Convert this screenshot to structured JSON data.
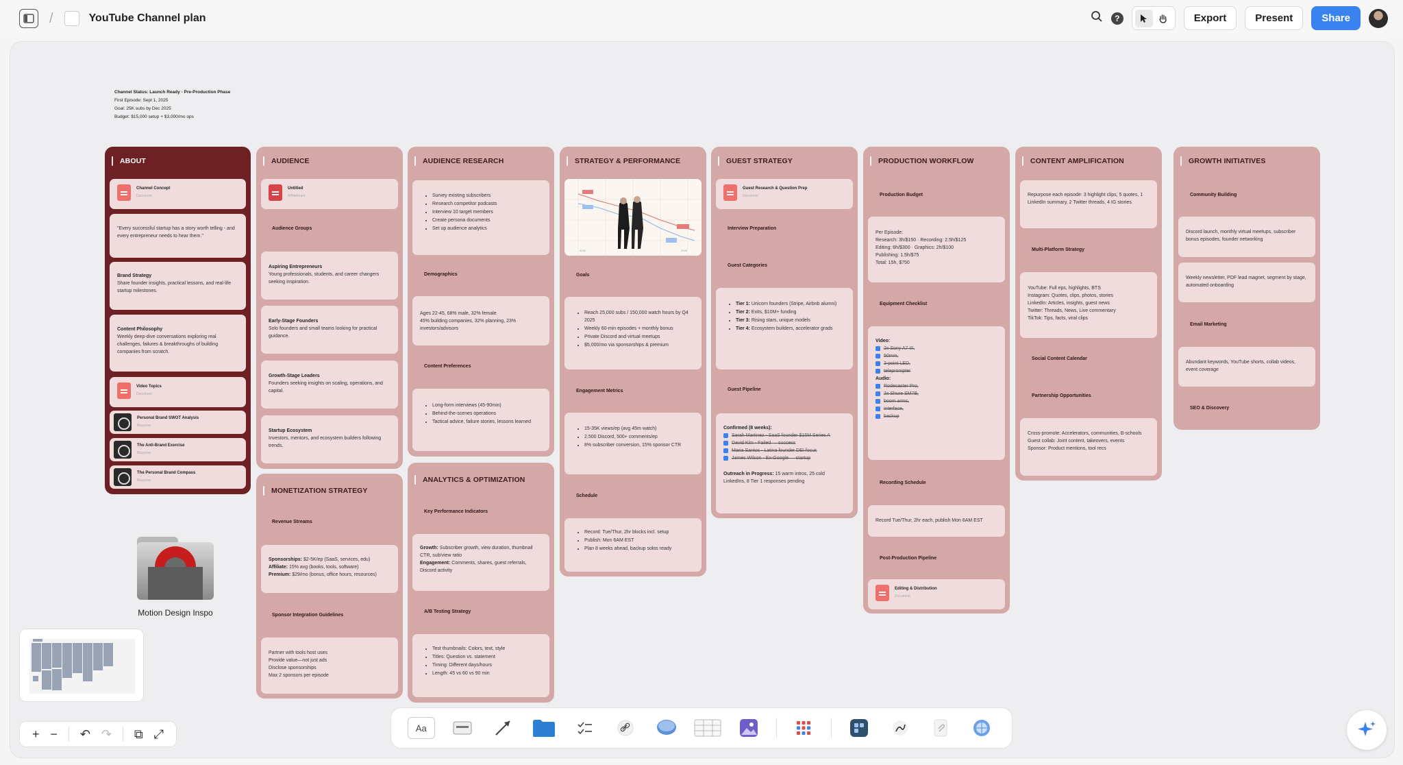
{
  "app": {
    "breadcrumb_sep": "/",
    "title": "YouTube Channel plan",
    "export_label": "Export",
    "present_label": "Present",
    "share_label": "Share",
    "help_glyph": "?"
  },
  "status": {
    "heading": "Channel Status: Launch Ready - Pre-Production Phase",
    "line1": "First Episode: Sept 1, 2025",
    "line2": "Goal: 25K subs by Dec 2025",
    "line3": "Budget: $15,000 setup + $3,000/mo ops"
  },
  "about": {
    "title": "ABOUT",
    "doc1": {
      "name": "Channel Concept",
      "sub": "Document"
    },
    "quote": "\"Every successful startup has a story worth telling - and every entrepreneur needs to hear them.\"",
    "brand_title": "Brand Strategy",
    "brand_body": "Share founder insights, practical lessons, and real-life startup milestones.",
    "philosophy_title": "Content Philosophy",
    "philosophy_body": "Weekly deep-dive conversations exploring real challenges, failures & breakthroughs of building companies from scratch.",
    "doc2": {
      "name": "Video Topics",
      "sub": "Document"
    },
    "bp1": {
      "name": "Personal Brand SWOT Analysis",
      "sub": "Blueprint"
    },
    "bp2": {
      "name": "The Anti-Brand Exercise",
      "sub": "Blueprint"
    },
    "bp3": {
      "name": "The Personal Brand Compass",
      "sub": "Blueprint"
    }
  },
  "audience": {
    "title": "AUDIENCE",
    "wb": {
      "name": "Untitled",
      "sub": "Whiteboard"
    },
    "groups_label": "Audience Groups",
    "g1_title": "Aspiring Entrepreneurs",
    "g1_body": "Young professionals, students, and career changers seeking inspiration.",
    "g2_title": "Early-Stage Founders",
    "g2_body": "Solo founders and small teams looking for practical guidance.",
    "g3_title": "Growth-Stage Leaders",
    "g3_body": "Founders seeking insights on scaling, operations, and capital.",
    "g4_title": "Startup Ecosystem",
    "g4_body": "Investors, mentors, and ecosystem builders following trends."
  },
  "monetization": {
    "title": "MONETIZATION STRATEGY",
    "revenue_label": "Revenue Streams",
    "r1_k": "Sponsorships:",
    "r1_v": " $2-5K/ep (SaaS, services, edu)",
    "r2_k": "Affiliate:",
    "r2_v": " 15% avg (books, tools, software)",
    "r3_k": "Premium:",
    "r3_v": " $29/mo (bonus, office hours, resources)",
    "sponsor_label": "Sponsor Integration Guidelines",
    "s1": "Partner with tools host uses",
    "s2": "Provide value—not just ads",
    "s3": "Disclose sponsorships",
    "s4": "Max 2 sponsors per episode"
  },
  "research": {
    "title": "AUDIENCE RESEARCH",
    "items": [
      "Survey existing subscribers",
      "Research competitor podcasts",
      "Interview 10 target members",
      "Create persona documents",
      "Set up audience analytics"
    ],
    "demo_label": "Demographics",
    "demo_l1": "Ages 22-45, 68% male, 32% female",
    "demo_l2": "45% building companies, 32% planning, 23% investors/advisors",
    "pref_label": "Content Preferences",
    "prefs": [
      "Long-form interviews (45-90min)",
      "Behind-the-scenes operations",
      "Tactical advice, failure stories, lessons learned"
    ]
  },
  "analytics": {
    "title": "ANALYTICS & OPTIMIZATION",
    "kpi_label": "Key Performance Indicators",
    "k1_k": "Growth:",
    "k1_v": " Subscriber growth, view duration, thumbnail CTR, sub/view ratio",
    "k2_k": "Engagement:",
    "k2_v": " Comments, shares, guest referrals, Discord activity",
    "ab_label": "A/B Testing Strategy",
    "ab": [
      "Test thumbnails: Colors, text, style",
      "Titles: Question vs. statement",
      "Timing: Different days/hours",
      "Length: 45 vs 60 vs 90 min"
    ]
  },
  "strategy": {
    "title": "STRATEGY & PERFORMANCE",
    "chart_tag_a": "2020",
    "chart_tag_b": "2025",
    "goals_label": "Goals",
    "goals": [
      "Reach 25,000 subs / 150,000 watch hours by Q4 2025",
      "Weekly 60-min episodes + monthly bonus",
      "Private Discord and virtual meetups",
      "$5,000/mo via sponsorships & premium"
    ],
    "eng_label": "Engagement Metrics",
    "eng": [
      "15-35K views/ep (avg 45m watch)",
      "2,500 Discord, 500+ comments/ep",
      "8% subscriber conversion, 15% sponsor CTR"
    ],
    "sched_label": "Schedule",
    "sched": [
      "Record: Tue/Thur, 2hr blocks incl. setup",
      "Publish: Mon 6AM EST",
      "Plan 8 weeks ahead, backup solos ready"
    ]
  },
  "guest": {
    "title": "GUEST STRATEGY",
    "doc": {
      "name": "Guest Research & Question Prep",
      "sub": "Document"
    },
    "prep_label": "Interview Preparation",
    "cat_label": "Guest Categories",
    "t1_k": "Tier 1:",
    "t1_v": " Unicorn founders (Stripe, Airbnb alumni)",
    "t2_k": "Tier 2:",
    "t2_v": " Exits, $10M+ funding",
    "t3_k": "Tier 3:",
    "t3_v": " Rising stars, unique models",
    "t4_k": "Tier 4:",
    "t4_v": " Ecosystem builders, accelerator grads",
    "pipeline_label": "Guest Pipeline",
    "confirmed": "Confirmed (8 weeks):",
    "c": [
      "Sarah Martinez - SaaS founder $15M Series A",
      "David Kim - Failed → success",
      "Maria Santos - Latina founder DEI focus",
      "James Wilson - Ex-Google → startup"
    ],
    "outreach_k": "Outreach in Progress:",
    "outreach_v": " 15 warm intros, 25 cold LinkedIns, 8 Tier 1 responses pending"
  },
  "production": {
    "title": "PRODUCTION WORKFLOW",
    "budget_label": "Production Budget",
    "b0": "Per Episode:",
    "b1": "Research: 3h/$150 · Recording: 2.5h/$125",
    "b2": "Editing: 6h/$300 · Graphics: 2h/$100",
    "b3": "Publishing: 1.5h/$75",
    "b4": "Total: 15h, $750",
    "equip_label": "Equipment Checklist",
    "video_label": "Video:",
    "video": [
      "2x Sony A7 III,",
      "50mm,",
      "3-point LED,",
      "teleprompter"
    ],
    "audio_label": "Audio:",
    "audio": [
      "Rodecaster Pro,",
      "2x Shure SM7B,",
      "boom arms,",
      "interface,",
      "backup"
    ],
    "rec_label": "Recording Schedule",
    "rec": "Record Tue/Thur, 2hr each, publish Mon 6AM EST",
    "post_label": "Post-Production Pipeline",
    "doc": {
      "name": "Editing & Distribution",
      "sub": "Document"
    }
  },
  "amplification": {
    "title": "CONTENT AMPLIFICATION",
    "repurpose": "Repurpose each episode: 3 highlight clips, 5 quotes, 1 LinkedIn summary, 2 Twitter threads, 4 IG stories",
    "multi_label": "Multi-Platform Strategy",
    "m": [
      "YouTube: Full eps, highlights, BTS",
      "Instagram: Quotes, clips, photos, stories",
      "LinkedIn: Articles, insights, guest news",
      "Twitter: Threads, News, Live commentary",
      "TikTok: Tips, facts, viral clips"
    ],
    "social_label": "Social Content Calendar",
    "partner_label": "Partnership Opportunities",
    "p": [
      "Cross-promote: Accelerators, communities, B-schools",
      "Guest collab: Joint content, takeovers, events",
      "Sponsor: Product mentions, tool recs"
    ]
  },
  "growth": {
    "title": "GROWTH INITIATIVES",
    "community_label": "Community Building",
    "c1": "Discord launch, monthly virtual meetups, subscriber bonus episodes, founder networking",
    "c2": "Weekly newsletter, PDF lead magnet, segment by stage, automated onboarding",
    "email_label": "Email Marketing",
    "e1": "Abundant keywords, YouTube shorts, collab videos, event coverage",
    "seo_label": "SEO & Discovery"
  },
  "folder": {
    "label": "Motion Design Inspo"
  },
  "zoom": {
    "plus": "+",
    "minus": "−",
    "undo": "↶",
    "redo": "↷",
    "fit": "⧉",
    "expand": "⤢"
  },
  "dock": {
    "text_tool": "Aa"
  }
}
